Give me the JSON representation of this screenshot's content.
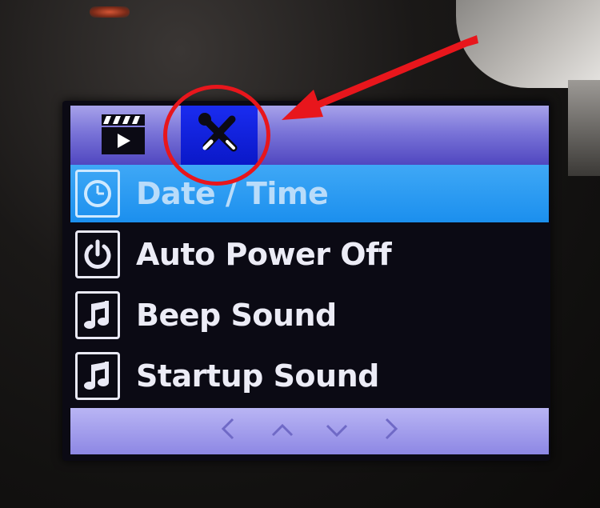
{
  "device": {
    "tabs": [
      {
        "name": "video",
        "icon": "film-clapper-icon",
        "active": false
      },
      {
        "name": "setup",
        "icon": "wrench-screwdriver-icon",
        "active": true
      }
    ],
    "menu": {
      "items": [
        {
          "label": "Date / Time",
          "icon": "clock-icon",
          "selected": true
        },
        {
          "label": "Auto Power Off",
          "icon": "power-icon",
          "selected": false
        },
        {
          "label": "Beep Sound",
          "icon": "music-note-icon",
          "selected": false
        },
        {
          "label": "Startup Sound",
          "icon": "music-note-icon",
          "selected": false
        }
      ]
    },
    "nav": {
      "left": "<",
      "up": "^",
      "down": "v",
      "right": ">"
    }
  },
  "annotation": {
    "color": "#e8161c",
    "marks": [
      "circle",
      "arrow"
    ]
  },
  "colors": {
    "topbar": "#7a74d8",
    "active_tab": "#0a18c8",
    "selected_row": "#1b8fee",
    "bottombar": "#b9b5f4",
    "text": "#ececf6"
  }
}
